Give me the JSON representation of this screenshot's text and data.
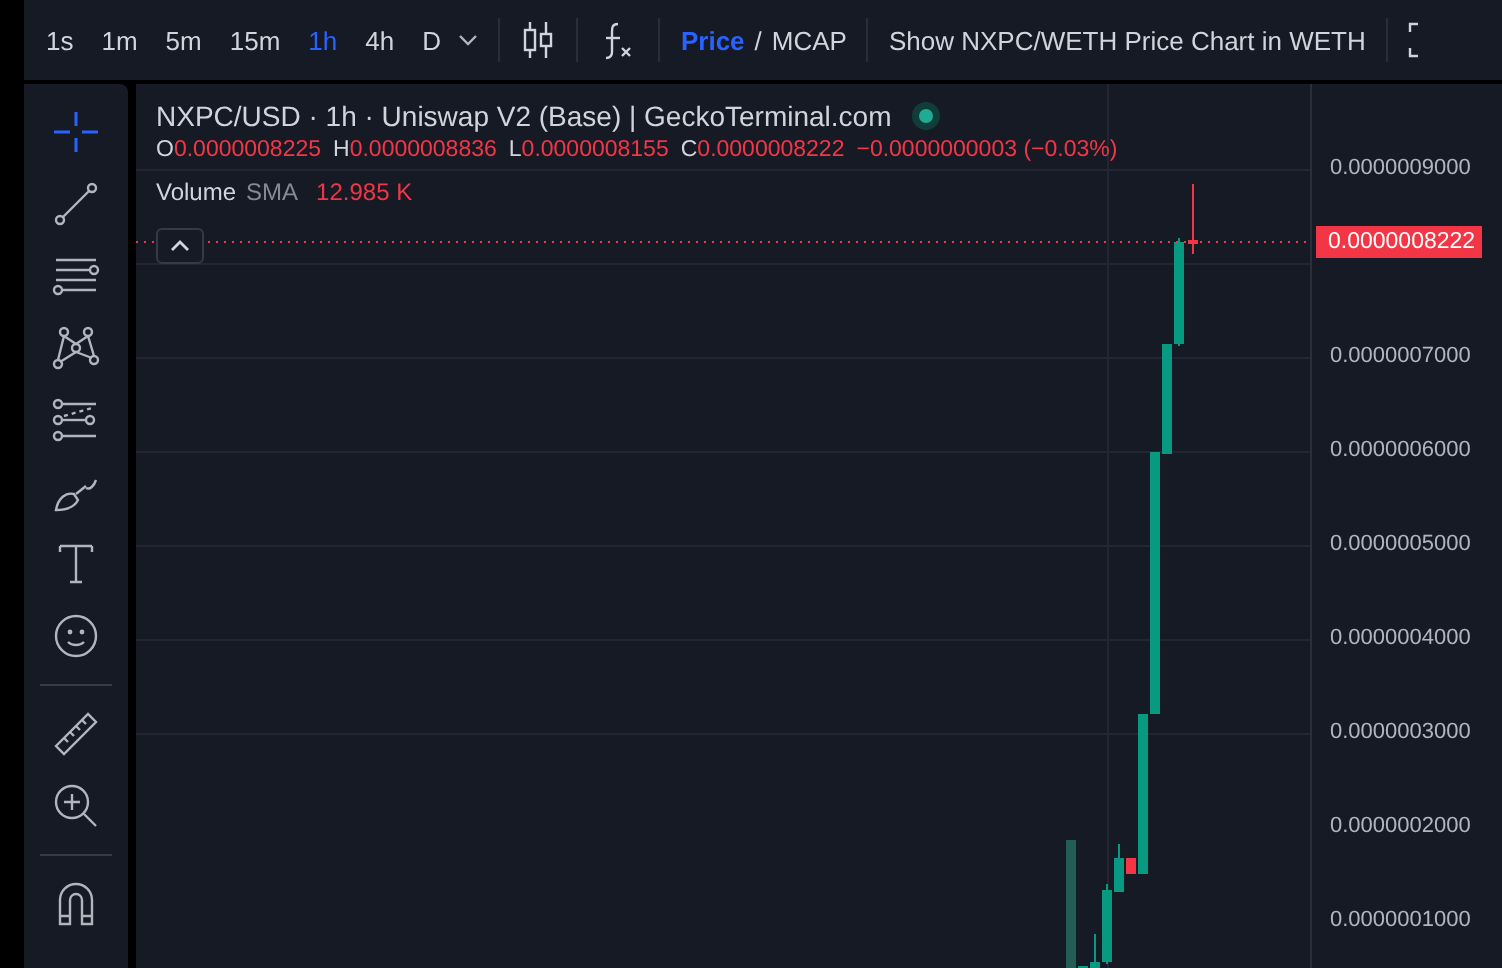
{
  "toolbar": {
    "intervals": [
      {
        "label": "1s",
        "selected": false
      },
      {
        "label": "1m",
        "selected": false
      },
      {
        "label": "5m",
        "selected": false
      },
      {
        "label": "15m",
        "selected": false
      },
      {
        "label": "1h",
        "selected": true
      },
      {
        "label": "4h",
        "selected": false
      },
      {
        "label": "D",
        "selected": false
      }
    ],
    "price_toggle": [
      {
        "label": "Price",
        "selected": true
      },
      {
        "label": "MCAP",
        "selected": false
      }
    ],
    "toggle_separator": "/",
    "chart_link": "Show NXPC/WETH Price Chart in WETH"
  },
  "drawing_tools": [
    {
      "kind": "crosshair",
      "selected": true
    },
    {
      "kind": "trendline",
      "selected": false
    },
    {
      "kind": "channel",
      "selected": false
    },
    {
      "kind": "pattern",
      "selected": false
    },
    {
      "kind": "fib",
      "selected": false
    },
    {
      "kind": "brush",
      "selected": false
    },
    {
      "kind": "text",
      "selected": false
    },
    {
      "kind": "emoji",
      "selected": false
    },
    {
      "kind": "divider"
    },
    {
      "kind": "ruler",
      "selected": false
    },
    {
      "kind": "zoom",
      "selected": false
    },
    {
      "kind": "divider"
    },
    {
      "kind": "magnet",
      "selected": false
    }
  ],
  "legend": {
    "title": "NXPC/USD · 1h · Uniswap V2 (Base) | GeckoTerminal.com",
    "ohlc": [
      {
        "key": "O",
        "value": "0.0000008225"
      },
      {
        "key": "H",
        "value": "0.0000008836"
      },
      {
        "key": "L",
        "value": "0.0000008155"
      },
      {
        "key": "C",
        "value": "0.0000008222"
      }
    ],
    "change": "−0.0000000003 (−0.03%)",
    "volume": {
      "label": "Volume",
      "indicator": "SMA",
      "value": "12.985 K"
    }
  },
  "price_axis": {
    "labels_above": [
      "0.0000009000"
    ],
    "labels": [
      "0.0000007000",
      "0.0000006000",
      "0.0000005000",
      "0.0000004000",
      "0.0000003000",
      "0.0000002000",
      "0.0000001000"
    ],
    "last_price": "0.0000008222"
  }
}
